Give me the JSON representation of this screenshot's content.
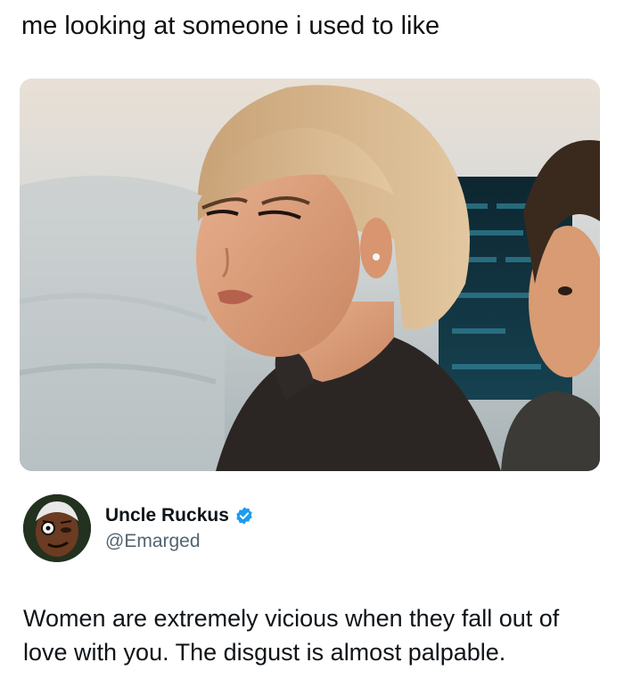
{
  "caption": "me looking at someone i used to like",
  "media": {
    "icon": "photo-still"
  },
  "author": {
    "display_name": "Uncle Ruckus",
    "handle": "@Emarged",
    "verified": true,
    "verified_color": "#1d9bf0"
  },
  "tweet": {
    "text": "Women are extremely vicious when they fall out of love with you. The disgust is almost palpable."
  }
}
